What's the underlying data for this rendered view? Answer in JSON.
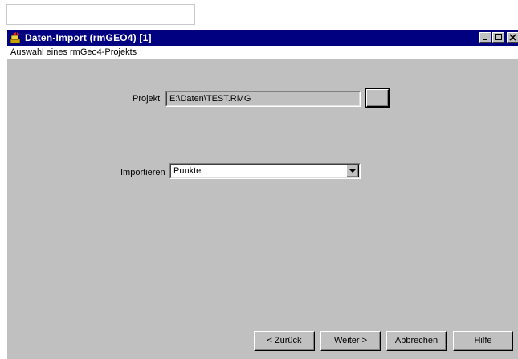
{
  "window": {
    "title": "Daten-Import (rmGEO4) [1]",
    "subtitle": "Auswahl eines rmGeo4-Projekts"
  },
  "form": {
    "project_label": "Projekt",
    "project_value": "E:\\Daten\\TEST.RMG",
    "browse_label": "...",
    "import_label": "Importieren",
    "import_value": "Punkte"
  },
  "buttons": {
    "back": "< Zurück",
    "next": "Weiter >",
    "cancel": "Abbrechen",
    "help": "Hilfe"
  },
  "icons": {
    "app": "app-import-icon",
    "minimize": "minimize-icon",
    "maximize": "maximize-icon",
    "close": "close-icon",
    "dropdown": "chevron-down-icon"
  },
  "colors": {
    "titlebar": "#000080",
    "dialog": "#c0c0c0"
  }
}
